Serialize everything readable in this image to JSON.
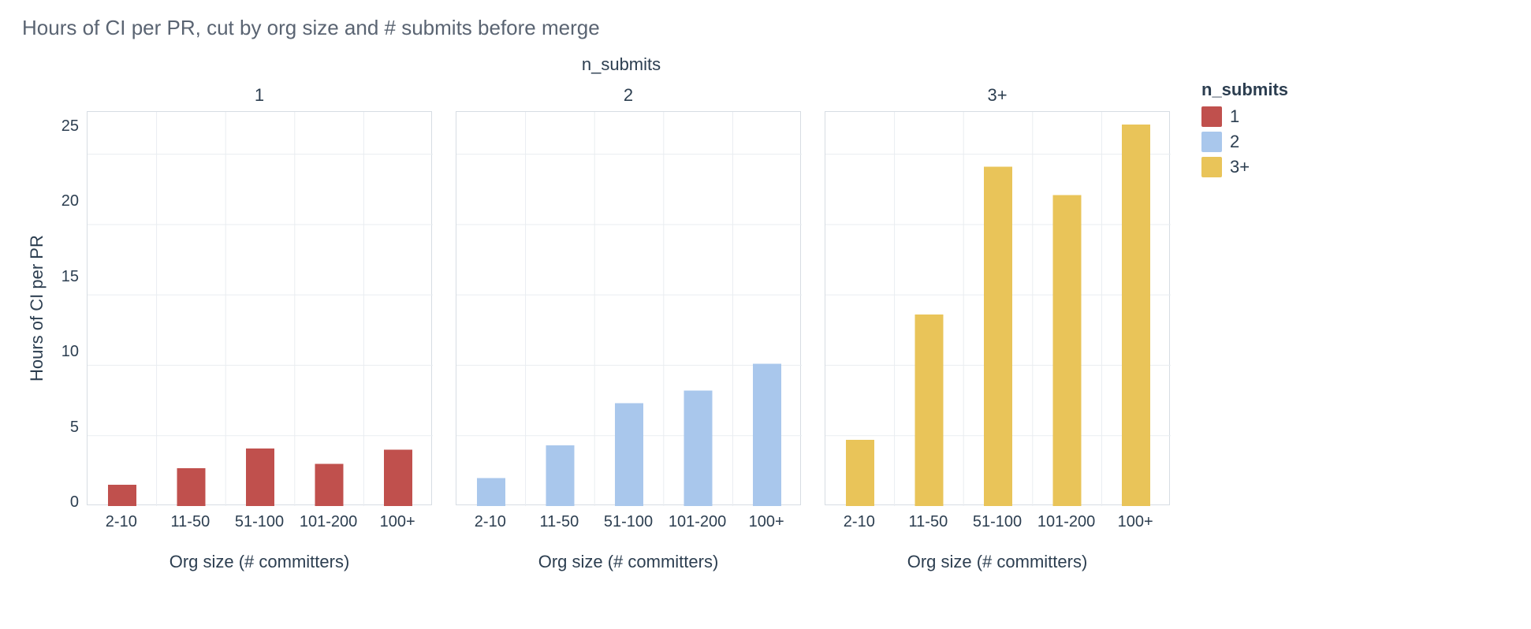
{
  "title": "Hours of CI per PR, cut by org size and # submits before merge",
  "facet_label": "n_submits",
  "ylabel": "Hours of CI per PR",
  "xlabel": "Org size (# committers)",
  "legend_title": "n_submits",
  "legend_items": [
    {
      "name": "1",
      "color": "#c0504d"
    },
    {
      "name": "2",
      "color": "#a9c7ec"
    },
    {
      "name": "3+",
      "color": "#e9c459"
    }
  ],
  "y_ticks": [
    "25",
    "20",
    "15",
    "10",
    "5",
    "0"
  ],
  "chart_data": {
    "type": "bar",
    "ylim": [
      0,
      28
    ],
    "ylabel": "Hours of CI per PR",
    "xlabel": "Org size (# committers)",
    "facet_by": "n_submits",
    "categories": [
      "2-10",
      "11-50",
      "51-100",
      "101-200",
      "100+"
    ],
    "facets": [
      {
        "name": "1",
        "color": "#c0504d",
        "values": [
          1.5,
          2.7,
          4.1,
          3.0,
          4.0
        ]
      },
      {
        "name": "2",
        "color": "#a9c7ec",
        "values": [
          2.0,
          4.3,
          7.3,
          8.2,
          10.1
        ]
      },
      {
        "name": "3+",
        "color": "#e9c459",
        "values": [
          4.7,
          13.6,
          24.1,
          22.1,
          27.1
        ]
      }
    ],
    "title": "Hours of CI per PR, cut by org size and # submits before merge"
  }
}
